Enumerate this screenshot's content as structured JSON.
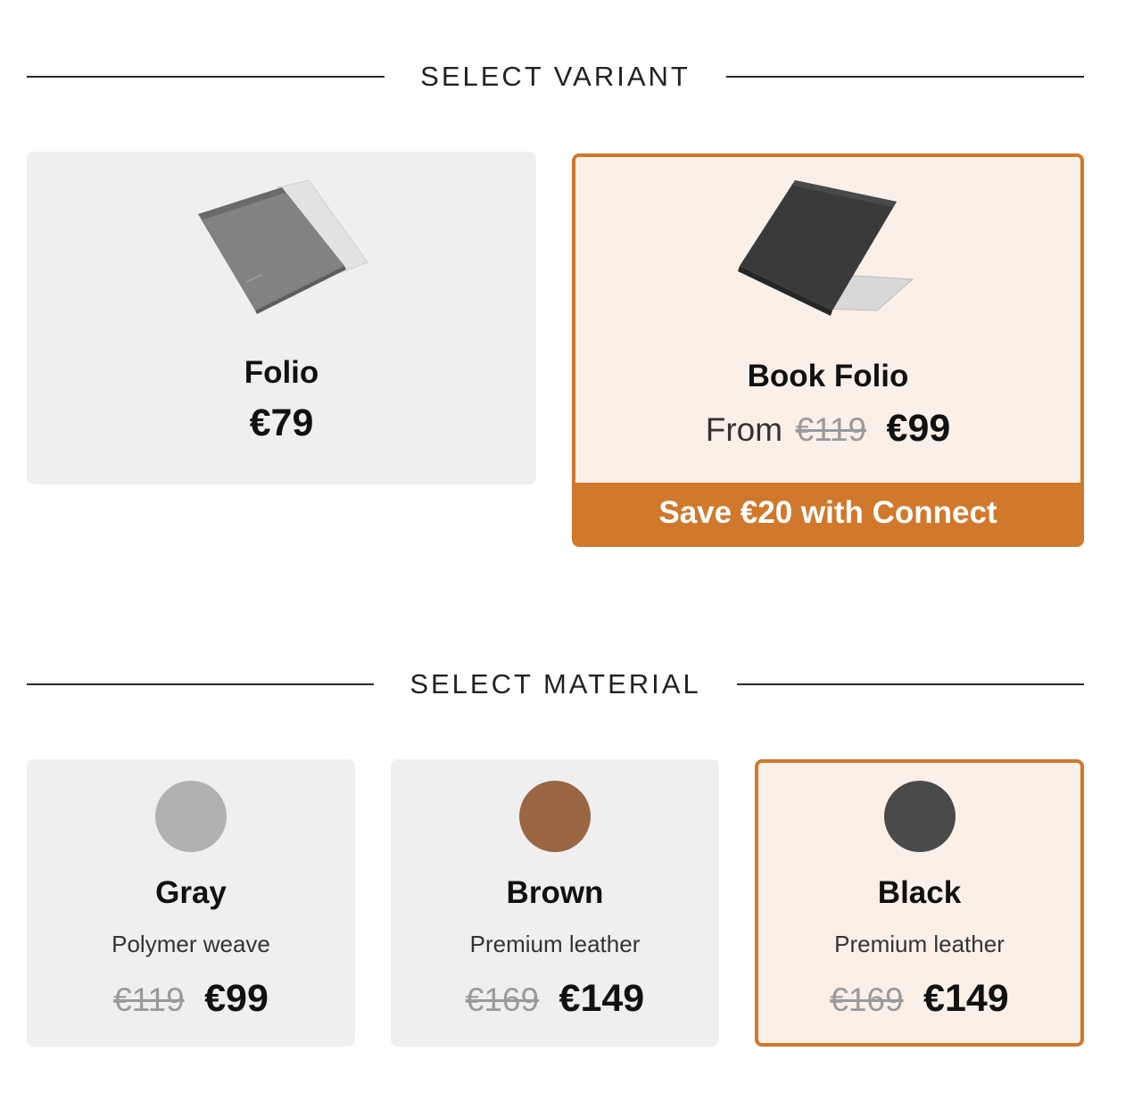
{
  "variant_section": {
    "title": "SELECT VARIANT",
    "cards": [
      {
        "name": "Folio",
        "price": "€79",
        "image": "gray-sleeve-image",
        "selected": false
      },
      {
        "name": "Book Folio",
        "from_label": "From",
        "old_price": "€119",
        "price": "€99",
        "promo": "Save €20 with Connect",
        "image": "black-book-folio-image",
        "selected": true
      }
    ]
  },
  "material_section": {
    "title": "SELECT MATERIAL",
    "cards": [
      {
        "name": "Gray",
        "description": "Polymer weave",
        "old_price": "€119",
        "price": "€99",
        "swatch_color": "#b1b1b1",
        "selected": false
      },
      {
        "name": "Brown",
        "description": "Premium leather",
        "old_price": "€169",
        "price": "€149",
        "swatch_color": "#9a6644",
        "selected": false
      },
      {
        "name": "Black",
        "description": "Premium leather",
        "old_price": "€169",
        "price": "€149",
        "swatch_color": "#4a4a4a",
        "selected": true
      }
    ]
  },
  "colors": {
    "accent": "#d0782c",
    "selected_bg": "#fbf0e8",
    "card_bg": "#efefef"
  }
}
